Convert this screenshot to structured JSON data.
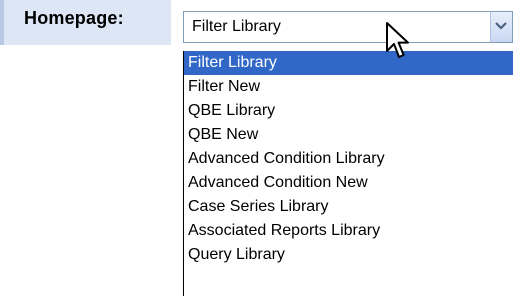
{
  "field": {
    "label": "Homepage:",
    "selected_value": "Filter Library"
  },
  "icons": {
    "dropdown_arrow": "chevron-down-icon",
    "cursor": "mouse-pointer-icon"
  },
  "colors": {
    "highlight": "#3168c8",
    "label_background": "#dde6f4",
    "select_border": "#7f9db9"
  },
  "options": [
    "Filter Library",
    "Filter New",
    "QBE Library",
    "QBE New",
    "Advanced Condition Library",
    "Advanced Condition New",
    "Case Series Library",
    "Associated Reports Library",
    "Query Library"
  ],
  "highlighted_index": 0
}
